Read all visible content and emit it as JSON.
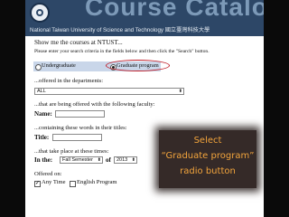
{
  "banner": {
    "title": "Course Catalog",
    "subtitle": "National Taiwan University of Science and Technology 國立臺灣科技大學"
  },
  "form": {
    "heading": "Show me the courses at NTUST...",
    "instructions": [
      "Please enter your search criteria in the fields below and then click the \"Search\" button."
    ],
    "level_options": [
      {
        "label": "Undergraduate",
        "selected": false
      },
      {
        "label": "Graduate program",
        "selected": true
      }
    ],
    "departments_label": "...offered in the departments:",
    "department_value": "ALL",
    "faculty_label": "...that are being offered with the following faculty:",
    "name_label": "Name:",
    "words_label": "...containing these words in their titles:",
    "title_label": "Title:",
    "times_label": "...that take place at these times:",
    "in_the_label": "In the:",
    "semester_value": "Fall Semester",
    "of_label": "of",
    "year_value": "2013",
    "offered_on_label": "Offered on:",
    "offered_options": [
      {
        "label": "Any Time",
        "checked": true
      },
      {
        "label": "English Program",
        "checked": false
      }
    ]
  },
  "callout": {
    "lines": [
      "Select",
      "“Graduate program”",
      "radio button"
    ],
    "text_color": "#f2a43c"
  },
  "colors": {
    "banner": "#2d4767",
    "highlight_bar": "#c9d6e9",
    "annotation_oval": "#c0202b"
  }
}
